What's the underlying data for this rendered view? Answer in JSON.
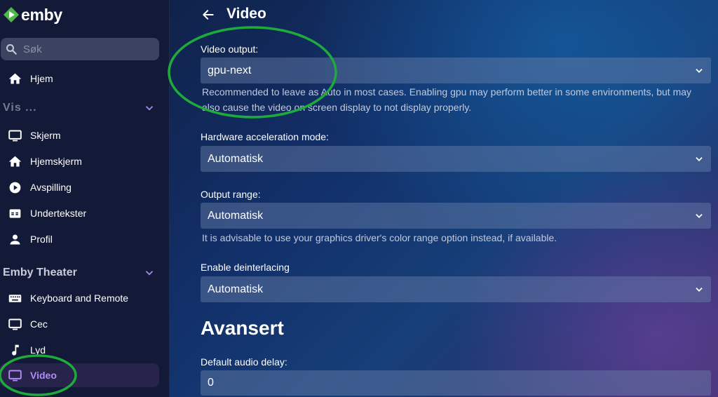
{
  "app": {
    "logo_text": "emby"
  },
  "search": {
    "placeholder": "Søk"
  },
  "sidebar": {
    "home_label": "Hjem",
    "section1_title": "Vis ...",
    "section1_items": [
      {
        "label": "Skjerm",
        "icon": "monitor-icon"
      },
      {
        "label": "Hjemskjerm",
        "icon": "home-icon"
      },
      {
        "label": "Avspilling",
        "icon": "play-circle-icon"
      },
      {
        "label": "Undertekster",
        "icon": "closed-caption-icon"
      },
      {
        "label": "Profil",
        "icon": "person-icon"
      }
    ],
    "section2_title": "Emby Theater",
    "section2_items": [
      {
        "label": "Keyboard and Remote",
        "icon": "keyboard-icon"
      },
      {
        "label": "Cec",
        "icon": "monitor-icon"
      },
      {
        "label": "Lyd",
        "icon": "music-note-icon"
      },
      {
        "label": "Video",
        "icon": "monitor-icon",
        "active": true
      }
    ]
  },
  "main": {
    "title": "Video",
    "fields": [
      {
        "label": "Video output:",
        "value": "gpu-next",
        "help": "Recommended to leave as Auto in most cases. Enabling gpu may perform better in some environments, but may also cause the video on screen display to not display properly."
      },
      {
        "label": "Hardware acceleration mode:",
        "value": "Automatisk"
      },
      {
        "label": "Output range:",
        "value": "Automatisk",
        "help": "It is advisable to use your graphics driver's color range option instead, if available."
      },
      {
        "label": "Enable deinterlacing",
        "value": "Automatisk"
      }
    ],
    "advanced_title": "Avansert",
    "audio_delay_label": "Default audio delay:",
    "audio_delay_value": "0"
  },
  "colors": {
    "accent": "#b18cf4",
    "annotation": "#1faa3c",
    "sidebar_bg": "#131a38"
  }
}
